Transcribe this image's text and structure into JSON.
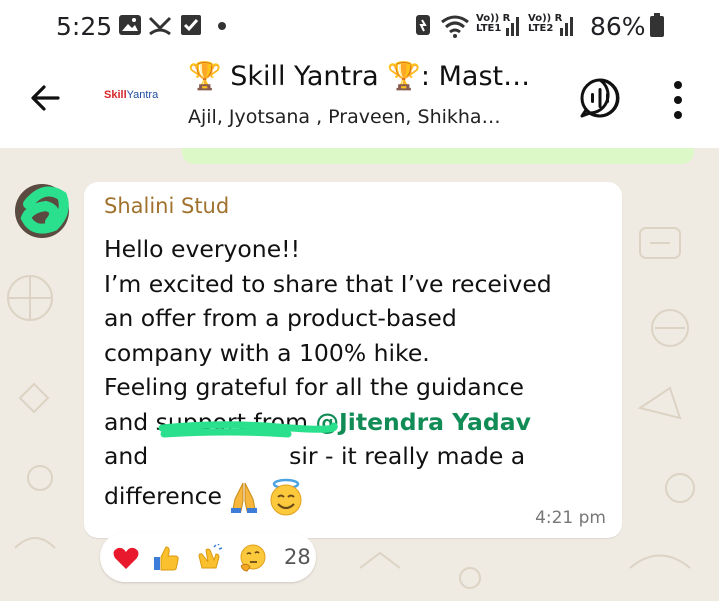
{
  "status_bar": {
    "time": "5:25",
    "battery_percent": "86%",
    "sim1": [
      "Vo)) R",
      "LTE1"
    ],
    "sim2": [
      "Vo)) R",
      "LTE2"
    ]
  },
  "header": {
    "logo_text_a": "Skill",
    "logo_text_b": "Yantra",
    "title": "🏆 Skill Yantra 🏆: Mast…",
    "subtitle": "Ajil, Jyotsana , Praveen, Shikha…"
  },
  "message": {
    "sender": "Shalini Stud",
    "line1": "Hello everyone!!",
    "line2": "I’m excited to share that I’ve received",
    "line3": "an offer from a product-based",
    "line4": "company with a 100% hike.",
    "line5": "Feeling grateful for all the guidance",
    "line6_prefix": "and support from ",
    "mention": "@Jitendra Yadav",
    "line7_prefix": "and ",
    "line7_suffix": " sir - it really made a",
    "line8": "difference",
    "time": "4:21 pm"
  },
  "reactions": {
    "count": "28",
    "icons": [
      "heart",
      "thumbs-up",
      "clapping-hands",
      "thinking-face"
    ]
  },
  "colors": {
    "sender": "#a0722d",
    "mention": "#128c56",
    "chat_background": "#efeae2",
    "outgoing_bubble": "#dcf8c6"
  }
}
